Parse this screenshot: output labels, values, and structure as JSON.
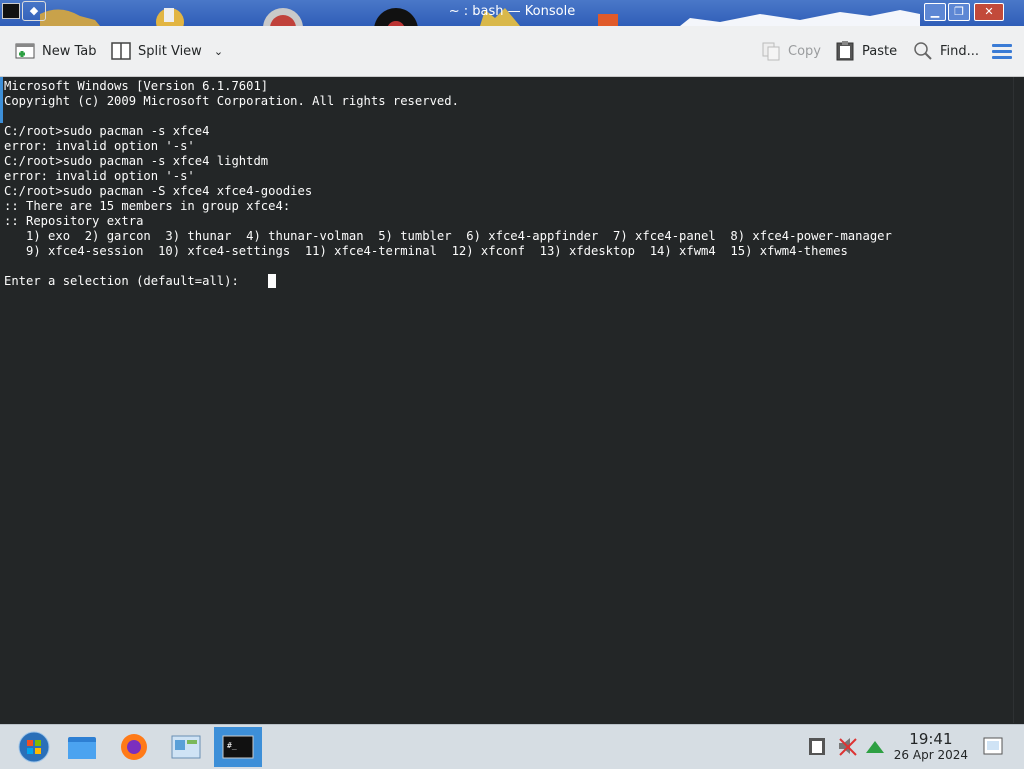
{
  "window": {
    "title": "~ : bash — Konsole"
  },
  "toolbar": {
    "new_tab": "New Tab",
    "split_view": "Split View",
    "copy": "Copy",
    "paste": "Paste",
    "find": "Find..."
  },
  "terminal": {
    "lines": [
      "Microsoft Windows [Version 6.1.7601]",
      "Copyright (c) 2009 Microsoft Corporation. All rights reserved.",
      "",
      "C:/root>sudo pacman -s xfce4",
      "error: invalid option '-s'",
      "C:/root>sudo pacman -s xfce4 lightdm",
      "error: invalid option '-s'",
      "C:/root>sudo pacman -S xfce4 xfce4-goodies",
      ":: There are 15 members in group xfce4:",
      ":: Repository extra",
      "   1) exo  2) garcon  3) thunar  4) thunar-volman  5) tumbler  6) xfce4-appfinder  7) xfce4-panel  8) xfce4-power-manager",
      "   9) xfce4-session  10) xfce4-settings  11) xfce4-terminal  12) xfconf  13) xfdesktop  14) xfwm4  15) xfwm4-themes",
      "",
      "Enter a selection (default=all): "
    ]
  },
  "taskbar": {
    "time": "19:41",
    "date": "26 Apr 2024"
  },
  "colors": {
    "terminal_bg": "#232627",
    "terminal_fg": "#fcfcfc",
    "accent": "#3d8fd8",
    "titlebar": "#2f5eb8"
  }
}
